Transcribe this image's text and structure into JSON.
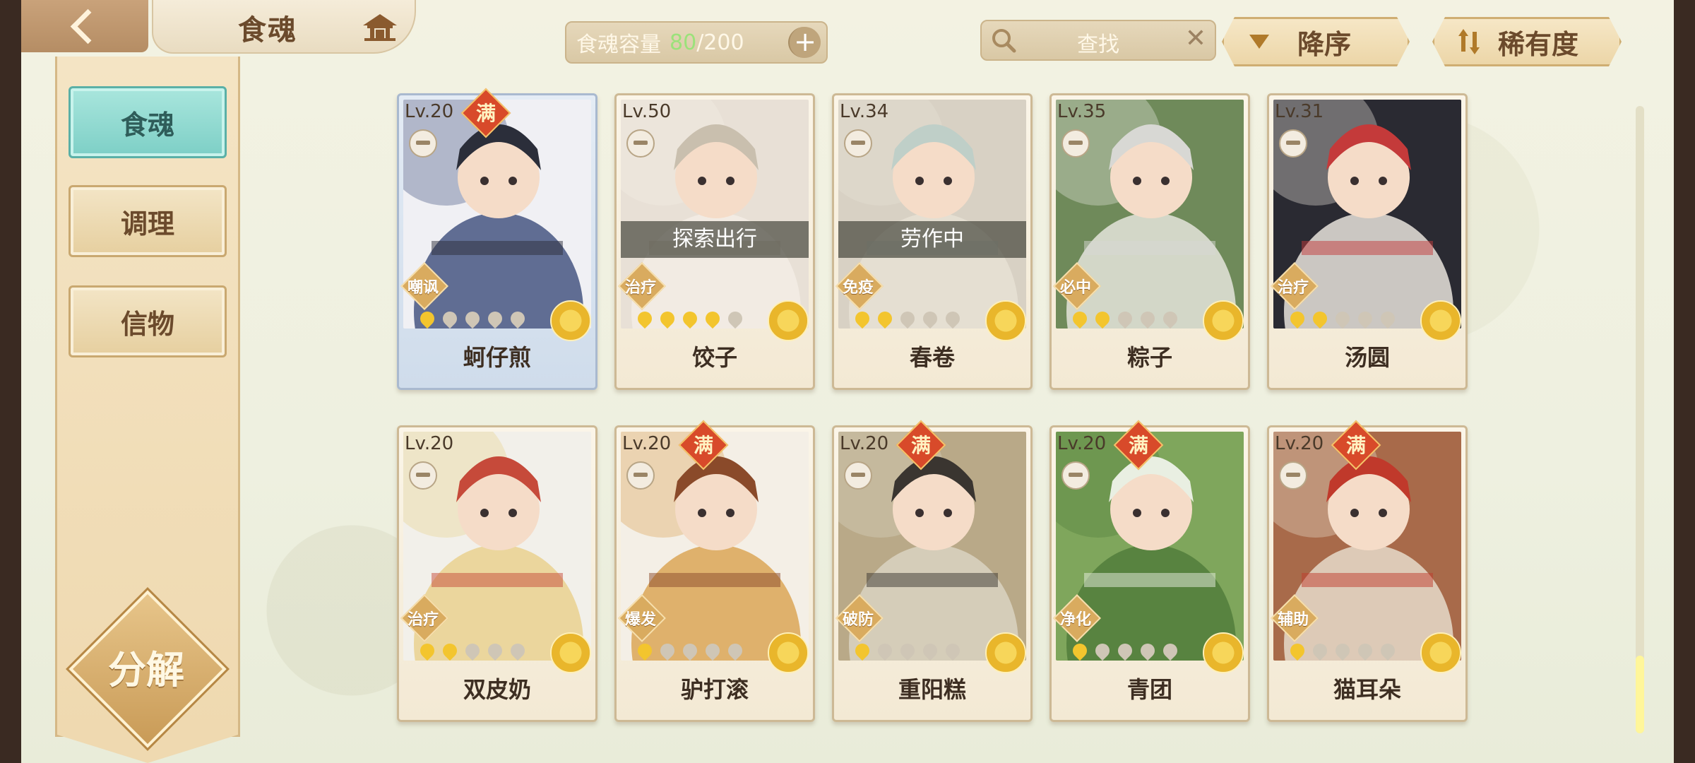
{
  "header": {
    "title": "食魂",
    "capacity": {
      "label": "食魂容量",
      "current": "80",
      "max": "/200"
    },
    "search": {
      "label": "查找"
    },
    "sort_order": "降序",
    "sort_key": "稀有度"
  },
  "sidebar": {
    "items": [
      {
        "label": "食魂",
        "active": true
      },
      {
        "label": "调理",
        "active": false
      },
      {
        "label": "信物",
        "active": false
      }
    ],
    "decompose": "分解"
  },
  "cards": [
    {
      "level": "Lv.20",
      "full": "满",
      "role": "嘲讽",
      "name": "蚵仔煎",
      "flames": 1,
      "status": "",
      "selected": true,
      "art": [
        "#3c4c7a",
        "#f0f0f4",
        "#2b2e3a"
      ]
    },
    {
      "level": "Lv.50",
      "full": "",
      "role": "治疗",
      "name": "饺子",
      "flames": 4,
      "status": "探索出行",
      "selected": false,
      "art": [
        "#f4eee6",
        "#e8e0d6",
        "#c9bfae"
      ]
    },
    {
      "level": "Lv.34",
      "full": "",
      "role": "免疫",
      "name": "春卷",
      "flames": 2,
      "status": "劳作中",
      "selected": false,
      "art": [
        "#e9e2d6",
        "#d8d1c4",
        "#bfcfc8"
      ]
    },
    {
      "level": "Lv.35",
      "full": "",
      "role": "必中",
      "name": "粽子",
      "flames": 2,
      "status": "",
      "selected": false,
      "art": [
        "#eceae4",
        "#6f8a5a",
        "#d8d8d4"
      ]
    },
    {
      "level": "Lv.31",
      "full": "",
      "role": "治疗",
      "name": "汤圆",
      "flames": 2,
      "status": "",
      "selected": false,
      "art": [
        "#f4efe6",
        "#2a2a32",
        "#c43a3a"
      ]
    },
    {
      "level": "Lv.20",
      "full": "",
      "role": "治疗",
      "name": "双皮奶",
      "flames": 2,
      "status": "",
      "selected": false,
      "art": [
        "#e8d08a",
        "#f2f0ea",
        "#c64a3a"
      ]
    },
    {
      "level": "Lv.20",
      "full": "满",
      "role": "爆发",
      "name": "驴打滚",
      "flames": 1,
      "status": "",
      "selected": false,
      "art": [
        "#d9a14e",
        "#f4efe6",
        "#8a4a2a"
      ]
    },
    {
      "level": "Lv.20",
      "full": "满",
      "role": "破防",
      "name": "重阳糕",
      "flames": 1,
      "status": "",
      "selected": false,
      "art": [
        "#dcd6c6",
        "#b9a988",
        "#3a3530"
      ]
    },
    {
      "level": "Lv.20",
      "full": "满",
      "role": "净化",
      "name": "青团",
      "flames": 1,
      "status": "",
      "selected": false,
      "art": [
        "#4f7a3a",
        "#7fa65c",
        "#e9efe2"
      ]
    },
    {
      "level": "Lv.20",
      "full": "满",
      "role": "辅助",
      "name": "猫耳朵",
      "flames": 1,
      "status": "",
      "selected": false,
      "art": [
        "#eae2d2",
        "#a86a4a",
        "#c0392b"
      ]
    }
  ]
}
